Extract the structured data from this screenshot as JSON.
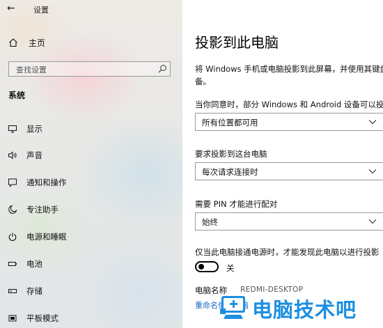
{
  "window": {
    "title": "设置"
  },
  "sidebar": {
    "home_label": "主页",
    "search_placeholder": "查找设置",
    "section_title": "系统",
    "items": [
      {
        "label": "显示",
        "icon": "monitor-icon"
      },
      {
        "label": "声音",
        "icon": "speaker-icon"
      },
      {
        "label": "通知和操作",
        "icon": "notification-icon"
      },
      {
        "label": "专注助手",
        "icon": "moon-icon"
      },
      {
        "label": "电源和睡眠",
        "icon": "power-icon"
      },
      {
        "label": "电池",
        "icon": "battery-icon"
      },
      {
        "label": "存储",
        "icon": "storage-icon"
      },
      {
        "label": "平板模式",
        "icon": "tablet-icon"
      }
    ]
  },
  "main": {
    "title": "投影到此电脑",
    "description": "将 Windows 手机或电脑投影到此屏幕，并使用其键盘",
    "description_cont": "备。",
    "q1_label": "当你同意时，部分 Windows 和 Android 设备可以投影",
    "q1_value": "所有位置都可用",
    "q2_label": "要求投影到这台电脑",
    "q2_value": "每次请求连接时",
    "q3_label": "需要 PIN 才能进行配对",
    "q3_value": "始终",
    "q4_label": "仅当此电脑接通电源时，才能发现此电脑以进行投影",
    "toggle_state": "关",
    "pc_name_label": "电脑名称",
    "pc_name_value": "REDMI-DESKTOP",
    "rename_link": "重命名你的电脑"
  },
  "watermark": {
    "text": "电脑技术吧"
  },
  "colors": {
    "accent": "#1a66c6",
    "watermark": "#1d8fe0"
  }
}
